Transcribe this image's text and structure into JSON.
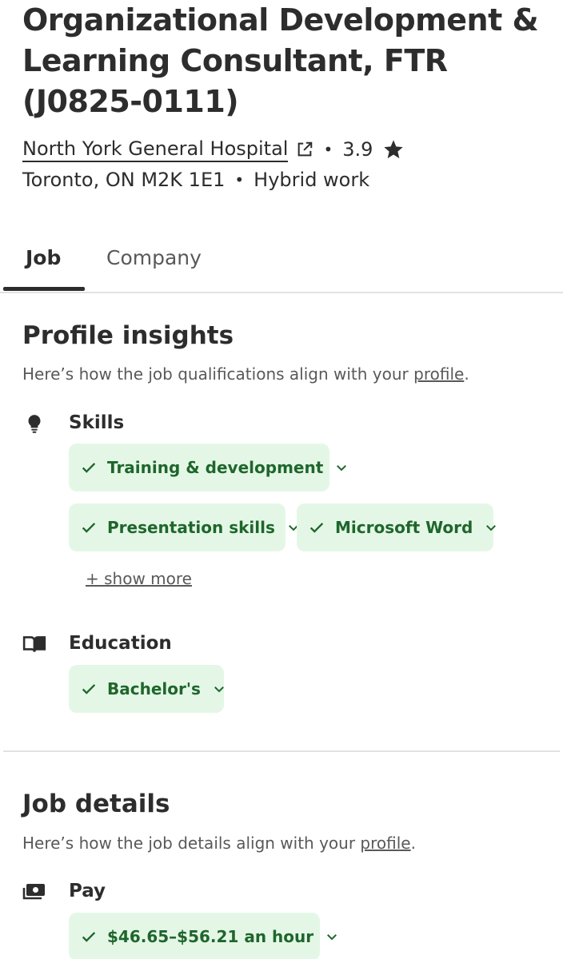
{
  "job": {
    "title": "Organizational Development & Learning Consultant, FTR (J0825-0111)",
    "company": "North York General Hospital",
    "rating": "3.9",
    "location": "Toronto, ON M2K 1E1",
    "work_type": "Hybrid work",
    "separator": "•"
  },
  "tabs": [
    {
      "label": "Job",
      "active": true
    },
    {
      "label": "Company",
      "active": false
    }
  ],
  "profile_insights": {
    "title": "Profile insights",
    "subtitle_prefix": "Here’s how the job qualifications align with your ",
    "subtitle_link": "profile",
    "subtitle_suffix": ".",
    "skills": {
      "label": "Skills",
      "icon": "lightbulb-icon",
      "chips": [
        "Training & development",
        "Presentation skills",
        "Microsoft Word"
      ],
      "show_more": "+ show more"
    },
    "education": {
      "label": "Education",
      "icon": "book-icon",
      "chips": [
        "Bachelor's"
      ]
    }
  },
  "job_details": {
    "title": "Job details",
    "subtitle_prefix": "Here’s how the job details align with your ",
    "subtitle_link": "profile",
    "subtitle_suffix": ".",
    "pay": {
      "label": "Pay",
      "icon": "money-icon",
      "chips": [
        "$46.65–$56.21 an hour"
      ]
    }
  },
  "colors": {
    "text": "#2d2d2d",
    "muted": "#595959",
    "chip_bg": "#e4f7e6",
    "chip_text": "#1f662c",
    "divider": "#e4e2e0"
  }
}
